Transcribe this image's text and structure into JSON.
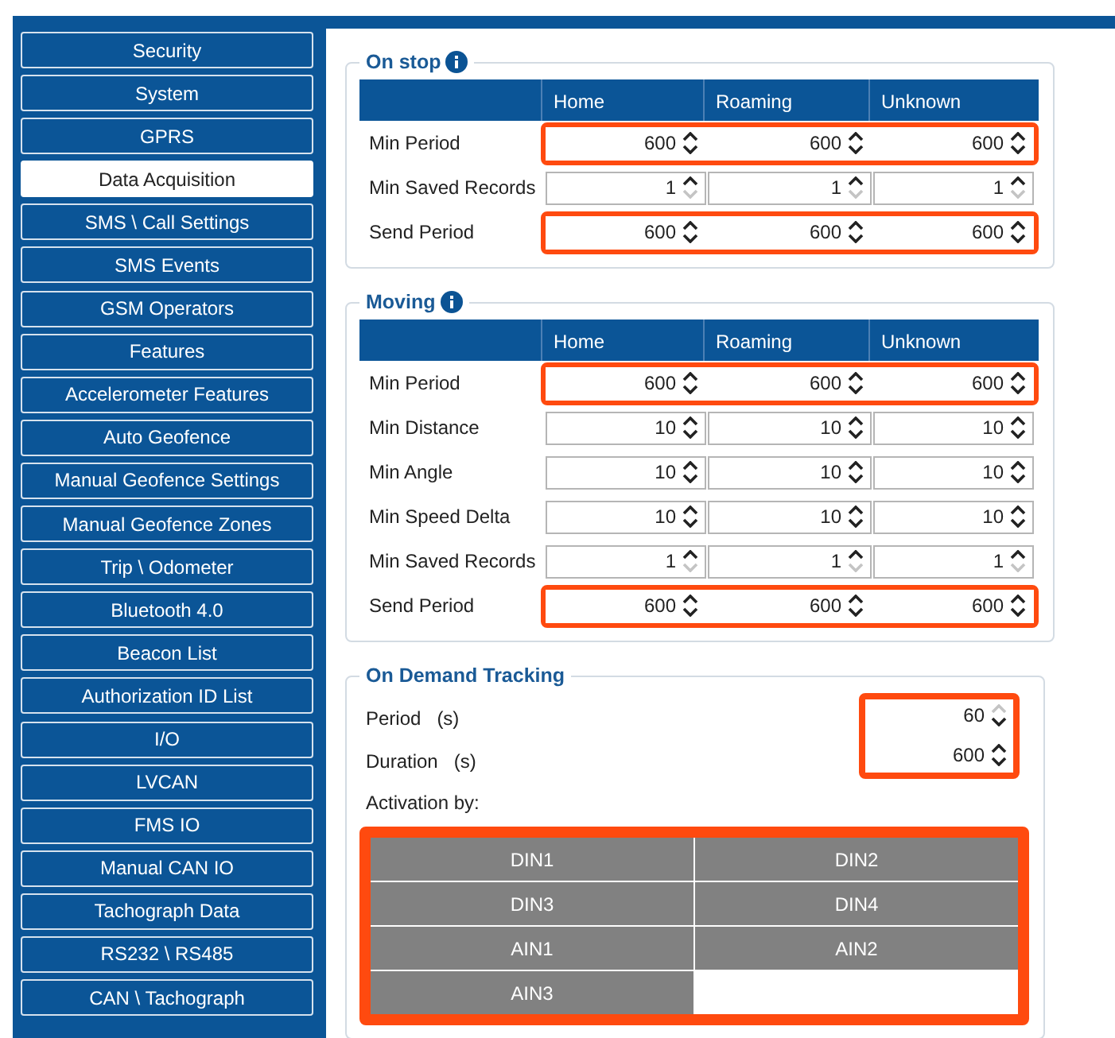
{
  "sidebar": {
    "items": [
      {
        "label": "Security",
        "selected": false
      },
      {
        "label": "System",
        "selected": false
      },
      {
        "label": "GPRS",
        "selected": false
      },
      {
        "label": "Data Acquisition",
        "selected": true
      },
      {
        "label": "SMS \\ Call Settings",
        "selected": false
      },
      {
        "label": "SMS Events",
        "selected": false
      },
      {
        "label": "GSM Operators",
        "selected": false
      },
      {
        "label": "Features",
        "selected": false
      },
      {
        "label": "Accelerometer Features",
        "selected": false
      },
      {
        "label": "Auto Geofence",
        "selected": false
      },
      {
        "label": "Manual Geofence Settings",
        "selected": false
      },
      {
        "label": "Manual Geofence Zones",
        "selected": false
      },
      {
        "label": "Trip \\ Odometer",
        "selected": false
      },
      {
        "label": "Bluetooth 4.0",
        "selected": false
      },
      {
        "label": "Beacon List",
        "selected": false
      },
      {
        "label": "Authorization ID List",
        "selected": false
      },
      {
        "label": "I/O",
        "selected": false
      },
      {
        "label": "LVCAN",
        "selected": false
      },
      {
        "label": "FMS IO",
        "selected": false
      },
      {
        "label": "Manual CAN IO",
        "selected": false
      },
      {
        "label": "Tachograph Data",
        "selected": false
      },
      {
        "label": "RS232 \\ RS485",
        "selected": false
      },
      {
        "label": "CAN \\ Tachograph",
        "selected": false
      }
    ]
  },
  "sections": [
    {
      "title": "On stop",
      "info": true,
      "columns": [
        "Home",
        "Roaming",
        "Unknown"
      ],
      "rows": [
        {
          "label": "Min Period",
          "highlighted": true,
          "down_disabled": false,
          "values": [
            "600",
            "600",
            "600"
          ]
        },
        {
          "label": "Min Saved Records",
          "highlighted": false,
          "down_disabled": true,
          "values": [
            "1",
            "1",
            "1"
          ]
        },
        {
          "label": "Send Period",
          "highlighted": true,
          "down_disabled": false,
          "values": [
            "600",
            "600",
            "600"
          ]
        }
      ]
    },
    {
      "title": "Moving",
      "info": true,
      "columns": [
        "Home",
        "Roaming",
        "Unknown"
      ],
      "rows": [
        {
          "label": "Min Period",
          "highlighted": true,
          "down_disabled": false,
          "values": [
            "600",
            "600",
            "600"
          ]
        },
        {
          "label": "Min Distance",
          "highlighted": false,
          "down_disabled": false,
          "values": [
            "10",
            "10",
            "10"
          ]
        },
        {
          "label": "Min Angle",
          "highlighted": false,
          "down_disabled": false,
          "values": [
            "10",
            "10",
            "10"
          ]
        },
        {
          "label": "Min Speed Delta",
          "highlighted": false,
          "down_disabled": false,
          "values": [
            "10",
            "10",
            "10"
          ]
        },
        {
          "label": "Min Saved Records",
          "highlighted": false,
          "down_disabled": true,
          "values": [
            "1",
            "1",
            "1"
          ]
        },
        {
          "label": "Send Period",
          "highlighted": true,
          "down_disabled": false,
          "values": [
            "600",
            "600",
            "600"
          ]
        }
      ]
    }
  ],
  "on_demand": {
    "title": "On Demand Tracking",
    "fields_highlighted": true,
    "fields": [
      {
        "label": "Period",
        "unit": "(s)",
        "value": "60",
        "up_disabled": true
      },
      {
        "label": "Duration",
        "unit": "(s)",
        "value": "600",
        "up_disabled": false
      }
    ],
    "activation_label": "Activation by:",
    "activation_highlighted": true,
    "buttons": [
      "DIN1",
      "DIN2",
      "DIN3",
      "DIN4",
      "AIN1",
      "AIN2",
      "AIN3"
    ]
  }
}
